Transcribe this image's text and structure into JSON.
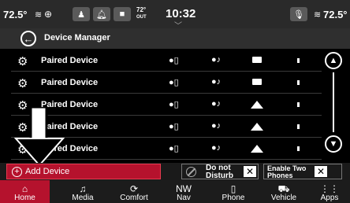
{
  "status": {
    "left_temp": "72.5°",
    "left_icons": [
      "seat-heat-icon",
      "steering-heat-icon"
    ],
    "outside_temp": "72°",
    "outside_label": "OUT",
    "time": "10:32",
    "right_temp": "72.5°"
  },
  "header": {
    "title": "Device Manager"
  },
  "devices": [
    {
      "name": "Paired Device",
      "phone": "●▯",
      "media": "●♪",
      "status_icon": "rect"
    },
    {
      "name": "Paired Device",
      "phone": "●▯",
      "media": "●♪",
      "status_icon": "rect"
    },
    {
      "name": "Paired Device",
      "phone": "●▯",
      "media": "●♪",
      "status_icon": "triangle"
    },
    {
      "name": "Paired Device",
      "phone": "●▯",
      "media": "●♪",
      "status_icon": "triangle"
    },
    {
      "name": "Paired Device",
      "phone": "●▯",
      "media": "●♪",
      "status_icon": "triangle"
    }
  ],
  "actions": {
    "add_device": "Add Device",
    "dnd_line1": "Do not",
    "dnd_line2": "Disturb",
    "two_line1": "Enable Two",
    "two_line2": "Phones"
  },
  "nav": [
    {
      "label": "Home",
      "icon": "⌂",
      "active": true
    },
    {
      "label": "Media",
      "icon": "♫",
      "active": false
    },
    {
      "label": "Comfort",
      "icon": "⟳",
      "active": false
    },
    {
      "label": "Nav",
      "icon": "NW",
      "active": false
    },
    {
      "label": "Phone",
      "icon": "▯",
      "active": false
    },
    {
      "label": "Vehicle",
      "icon": "⛟",
      "active": false
    },
    {
      "label": "Apps",
      "icon": "⋮⋮",
      "active": false
    }
  ],
  "colors": {
    "accent": "#b5122d",
    "bar": "#2a2a2a"
  }
}
